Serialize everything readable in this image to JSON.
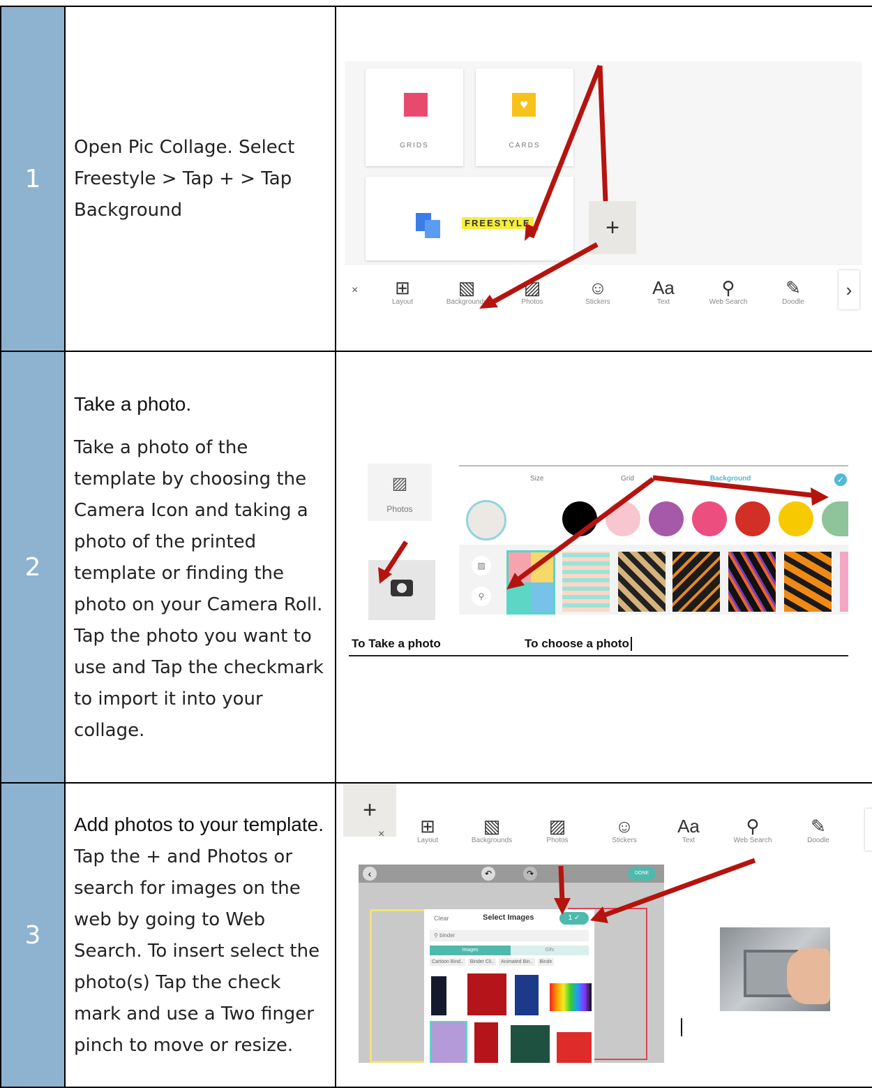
{
  "rows": [
    {
      "number": "1",
      "text": "Open Pic Collage. Select Freestyle > Tap + > Tap Background",
      "screenshot": {
        "cards": [
          "GRIDS",
          "CARDS"
        ],
        "freestyle_label": "FREESTYLE",
        "plus": "+",
        "close": "×",
        "toolbar": [
          {
            "icon": "layout-icon",
            "glyph": "⊞",
            "label": "Layout"
          },
          {
            "icon": "backgrounds-icon",
            "glyph": "▧",
            "label": "Backgrounds"
          },
          {
            "icon": "photos-icon",
            "glyph": "▨",
            "label": "Photos"
          },
          {
            "icon": "stickers-icon",
            "glyph": "☺",
            "label": "Stickers"
          },
          {
            "icon": "text-icon",
            "glyph": "Aa",
            "label": "Text"
          },
          {
            "icon": "web-search-icon",
            "glyph": "⚲",
            "label": "Web Search"
          },
          {
            "icon": "doodle-icon",
            "glyph": "✎",
            "label": "Doodle"
          }
        ],
        "next": "›"
      }
    },
    {
      "number": "2",
      "heading": "Take a photo.",
      "text": "Take a photo of the template by choosing the Camera Icon and taking a photo of the printed template or finding the photo on your Camera Roll. Tap the photo you want to use and Tap the checkmark to import it into your collage.",
      "screenshot": {
        "photos_label": "Photos",
        "tabs": [
          "Size",
          "Grid",
          "Background"
        ],
        "captions": [
          "To Take a photo",
          "To choose a photo"
        ],
        "swatches": [
          "#ece9e4",
          "#ffffff",
          "#000000",
          "#f7c6cf",
          "#a559a8",
          "#ec4f7f",
          "#d22f27",
          "#f7c900",
          "#8fc39a"
        ]
      }
    },
    {
      "number": "3",
      "heading": "Add photos to your template.",
      "text": " Tap the + and Photos or search for images on the web by going to Web Search. To insert select the photo(s) Tap the check mark and use a Two finger pinch to move or resize.",
      "screenshot": {
        "toolbar": [
          {
            "icon": "layout-icon",
            "glyph": "⊞",
            "label": "Layout"
          },
          {
            "icon": "backgrounds-icon",
            "glyph": "▧",
            "label": "Backgrounds"
          },
          {
            "icon": "photos-icon",
            "glyph": "▨",
            "label": "Photos"
          },
          {
            "icon": "stickers-icon",
            "glyph": "☺",
            "label": "Stickers"
          },
          {
            "icon": "text-icon",
            "glyph": "Aa",
            "label": "Text"
          },
          {
            "icon": "web-search-icon",
            "glyph": "⚲",
            "label": "Web Search"
          },
          {
            "icon": "doodle-icon",
            "glyph": "✎",
            "label": "Doodle"
          }
        ],
        "dialog_title": "Select Images",
        "clear": "Clear",
        "search_value": "binder",
        "tabs": [
          "Images",
          "Gifs"
        ],
        "chips": [
          "Cartoon Bind..",
          "Binder Cli..",
          "Animated Bin..",
          "Binde"
        ],
        "done": "DONE"
      }
    }
  ]
}
